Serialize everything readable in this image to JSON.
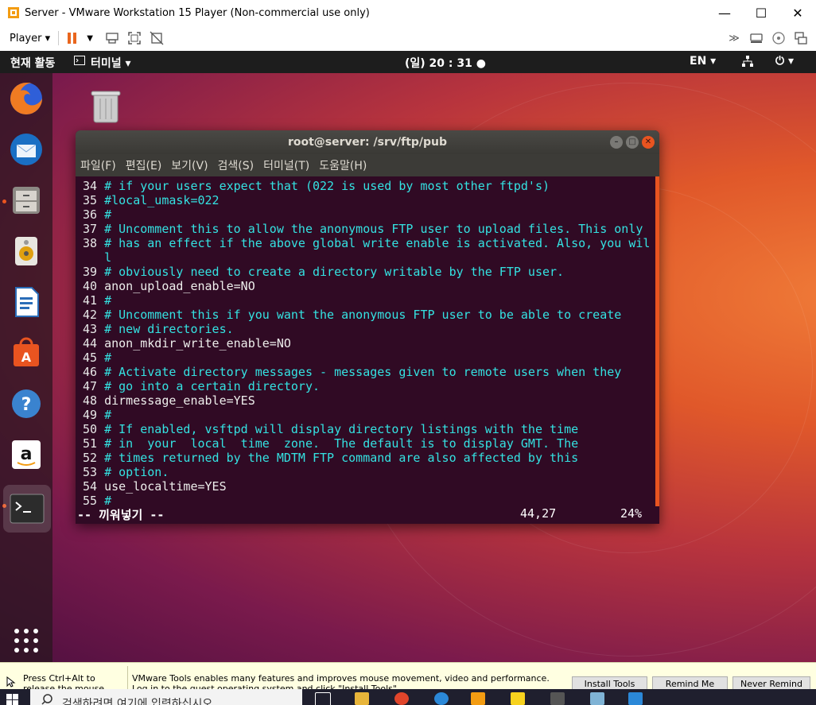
{
  "vmware": {
    "window_title": "Server - VMware Workstation 15 Player (Non-commercial use only)",
    "player_menu": "Player ▾",
    "minimize": "—",
    "maximize": "☐",
    "close": "✕"
  },
  "ubuntu_topbar": {
    "activities": "현재 활동",
    "app_menu": "터미널 ▾",
    "clock": "(일) 20 : 31 ●",
    "language": "EN ▾",
    "power": "⏻ ▾"
  },
  "dock": {
    "items": [
      "firefox",
      "thunderbird",
      "files",
      "rhythmbox",
      "libreoffice-writer",
      "ubuntu-software",
      "help",
      "amazon",
      "terminal"
    ]
  },
  "terminal": {
    "title": "root@server: /srv/ftp/pub",
    "menu": [
      "파일(F)",
      "편집(E)",
      "보기(V)",
      "검색(S)",
      "터미널(T)",
      "도움말(H)"
    ],
    "lines": [
      {
        "n": "34",
        "t": "# if your users expect that (022 is used by most other ftpd's)",
        "c": "cm"
      },
      {
        "n": "35",
        "t": "#local_umask=022",
        "c": "cm"
      },
      {
        "n": "36",
        "t": "#",
        "c": "cm"
      },
      {
        "n": "37",
        "t": "# Uncomment this to allow the anonymous FTP user to upload files. This only",
        "c": "cm"
      },
      {
        "n": "38",
        "t": "# has an effect if the above global write enable is activated. Also, you wil",
        "c": "cm"
      },
      {
        "n": "",
        "t": "l",
        "c": "cm"
      },
      {
        "n": "39",
        "t": "# obviously need to create a directory writable by the FTP user.",
        "c": "cm"
      },
      {
        "n": "40",
        "t": "anon_upload_enable=NO",
        "c": "tx"
      },
      {
        "n": "41",
        "t": "#",
        "c": "cm"
      },
      {
        "n": "42",
        "t": "# Uncomment this if you want the anonymous FTP user to be able to create",
        "c": "cm"
      },
      {
        "n": "43",
        "t": "# new directories.",
        "c": "cm"
      },
      {
        "n": "44",
        "t": "anon_mkdir_write_enable=NO",
        "c": "tx"
      },
      {
        "n": "45",
        "t": "#",
        "c": "cm"
      },
      {
        "n": "46",
        "t": "# Activate directory messages - messages given to remote users when they",
        "c": "cm"
      },
      {
        "n": "47",
        "t": "# go into a certain directory.",
        "c": "cm"
      },
      {
        "n": "48",
        "t": "dirmessage_enable=YES",
        "c": "tx"
      },
      {
        "n": "49",
        "t": "#",
        "c": "cm"
      },
      {
        "n": "50",
        "t": "# If enabled, vsftpd will display directory listings with the time",
        "c": "cm"
      },
      {
        "n": "51",
        "t": "# in  your  local  time  zone.  The default is to display GMT. The",
        "c": "cm"
      },
      {
        "n": "52",
        "t": "# times returned by the MDTM FTP command are also affected by this",
        "c": "cm"
      },
      {
        "n": "53",
        "t": "# option.",
        "c": "cm"
      },
      {
        "n": "54",
        "t": "use_localtime=YES",
        "c": "tx"
      },
      {
        "n": "55",
        "t": "#",
        "c": "cm"
      }
    ],
    "status_mode": "-- 끼워넣기 --",
    "status_pos": "44,27",
    "status_pct": "24%"
  },
  "notification": {
    "release_hint": "Press Ctrl+Alt to release the mouse cursor.",
    "message": "VMware Tools enables many features and improves mouse movement, video and performance. Log in to the guest operating system and click \"Install Tools\".",
    "install_button": "Install Tools",
    "remind_later_button": "Remind Me Later",
    "never_remind_button": "Never Remind Me"
  },
  "taskbar": {
    "search_placeholder": "검색하려면 여기에 입력하십시오."
  },
  "colors": {
    "ubuntu_orange": "#e95420",
    "terminal_bg": "#300a24",
    "comment_cyan": "#34e2e2"
  }
}
